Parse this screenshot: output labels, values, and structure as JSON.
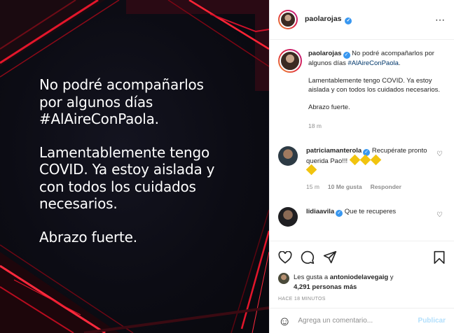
{
  "post": {
    "paragraphs": [
      "No podré acompañarlos\npor algunos días\n#AlAireConPaola.",
      "Lamentablemente tengo\nCOVID. Ya estoy aislada y\ncon todos los cuidados\nnecesarios.",
      "Abrazo fuerte."
    ],
    "accent_color": "#e3162b"
  },
  "header": {
    "username": "paolarojas",
    "verified_mark": "✓",
    "more_icon": "⋯"
  },
  "caption": {
    "username": "paolarojas",
    "line1": " No podré acompañarlos por algunos días ",
    "hashtag": "#AlAireConPaola",
    "line1_end": ".",
    "para2": "Lamentablemente tengo COVID. Ya estoy aislada y con todos los cuidados necesarios.",
    "para3": "Abrazo fuerte.",
    "time": "18 m"
  },
  "comments": [
    {
      "username": "patriciamanterola",
      "text": " Recupérate pronto querida Pao!!! ",
      "time": "15 m",
      "likes": "10 Me gusta",
      "reply": "Responder"
    },
    {
      "username": "lidiaavila",
      "text": " Que te recuperes"
    }
  ],
  "likes": {
    "prefix": "Les gusta a ",
    "user": "antoniodelavegaig",
    "middle": " y ",
    "count": "4,291 personas más"
  },
  "timestamp": "HACE 18 MINUTOS",
  "add_comment": {
    "placeholder": "Agrega un comentario...",
    "publish": "Publicar"
  },
  "icons": [
    "heart-icon",
    "comment-icon",
    "share-icon",
    "bookmark-icon",
    "emoji-icon",
    "more-icon"
  ]
}
